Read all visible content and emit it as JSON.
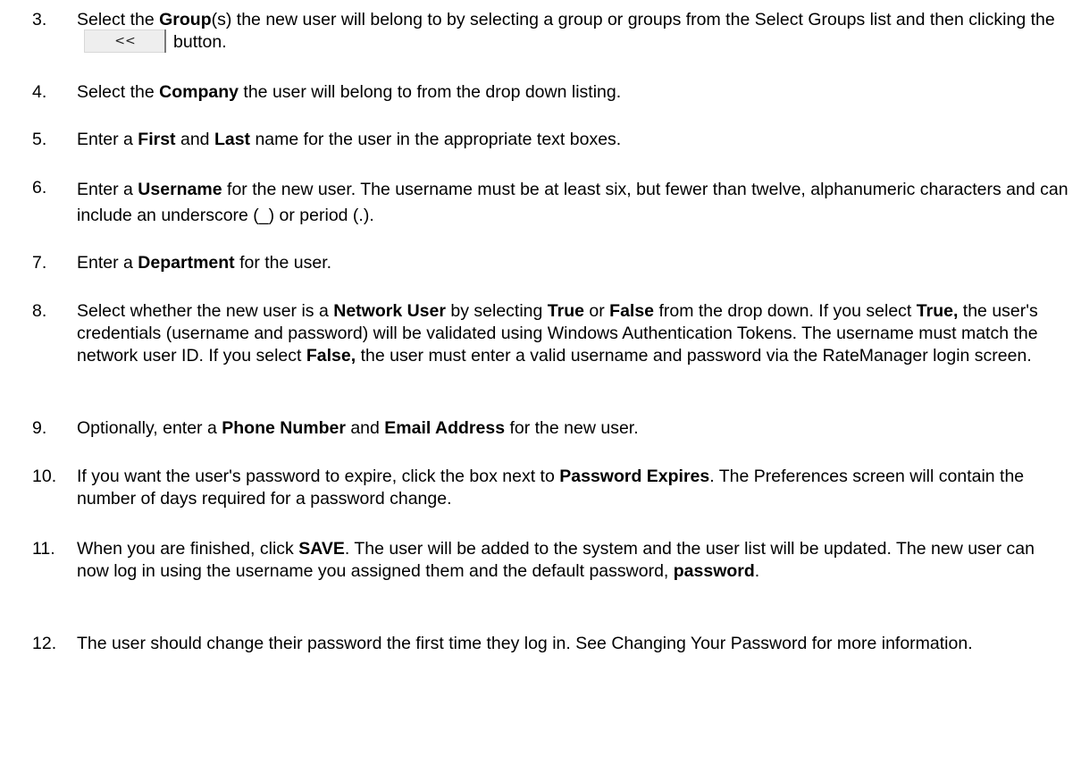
{
  "steps": [
    {
      "num": "3.",
      "segments": [
        "Select the ",
        "Group",
        "(s) the new user will belong to by selecting a group or groups from the Select Groups list and then clicking the",
        "button."
      ],
      "button_label": "<<"
    },
    {
      "num": "4.",
      "segments": [
        "Select the ",
        "Company",
        " the user will belong to from the drop down listing."
      ]
    },
    {
      "num": "5.",
      "segments": [
        "Enter a ",
        "First",
        " and ",
        "Last",
        " name for the user in the appropriate text boxes."
      ]
    },
    {
      "num": "6.",
      "segments": [
        "Enter a ",
        "Username",
        " for the new user. The username must be at least six, but fewer than twelve, alphanumeric characters and can include an underscore (_) or period (.)."
      ]
    },
    {
      "num": "7.",
      "segments": [
        "Enter a ",
        "Department",
        " for the user."
      ]
    },
    {
      "num": "8.",
      "segments": [
        "Select whether the new user is a ",
        "Network User",
        " by selecting ",
        "True",
        " or ",
        "False",
        " from the drop down. If you select ",
        "True,",
        " the user's credentials (username and password) will be validated using Windows Authentication Tokens. The username must match the network user ID.  If you select ",
        "False,",
        " the user must enter a valid username and password via the RateManager login screen."
      ]
    },
    {
      "num": "9.",
      "segments": [
        "Optionally, enter a ",
        "Phone Number",
        " and ",
        "Email Address",
        " for the new user."
      ]
    },
    {
      "num": "10.",
      "segments": [
        "If you want the user's password to expire, click the box next to ",
        "Password Expires",
        ". The Preferences screen will contain the number of days required for a password change."
      ]
    },
    {
      "num": "11.",
      "segments": [
        "When you are finished, click ",
        "SAVE",
        ". The user will be added to the system and the user list will be updated. The new user can now log in using the username you assigned them and the default password, ",
        "password",
        "."
      ]
    },
    {
      "num": "12.",
      "segments": [
        "The user should change their password the first time they log in. See Changing Your Password for more information."
      ]
    }
  ]
}
